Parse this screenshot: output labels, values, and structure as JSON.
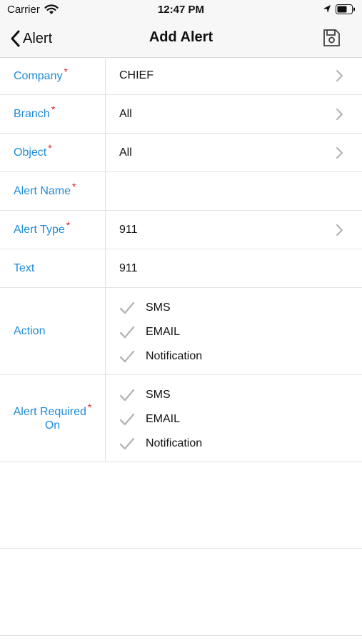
{
  "status_bar": {
    "carrier": "Carrier",
    "time": "12:47 PM"
  },
  "nav": {
    "back_label": "Alert",
    "title": "Add Alert",
    "save_icon": "floppy-disk-icon"
  },
  "colors": {
    "label": "#1e8bd6",
    "required": "#e0202a",
    "check": "#b5b5b5"
  },
  "form": {
    "company": {
      "label": "Company",
      "required": "*",
      "value": "CHIEF"
    },
    "branch": {
      "label": "Branch",
      "required": "*",
      "value": "All"
    },
    "object": {
      "label": "Object",
      "required": "*",
      "value": "All"
    },
    "alert_name": {
      "label": "Alert Name",
      "required": "*",
      "value": ""
    },
    "alert_type": {
      "label": "Alert Type",
      "required": "*",
      "value": "911"
    },
    "text": {
      "label": "Text",
      "value": "911"
    },
    "action": {
      "label": "Action",
      "options": [
        "SMS",
        "EMAIL",
        "Notification"
      ]
    },
    "alert_required_on": {
      "label_line1": "Alert Required",
      "label_line2": "On",
      "required": "*",
      "options": [
        "SMS",
        "EMAIL",
        "Notification"
      ]
    }
  }
}
